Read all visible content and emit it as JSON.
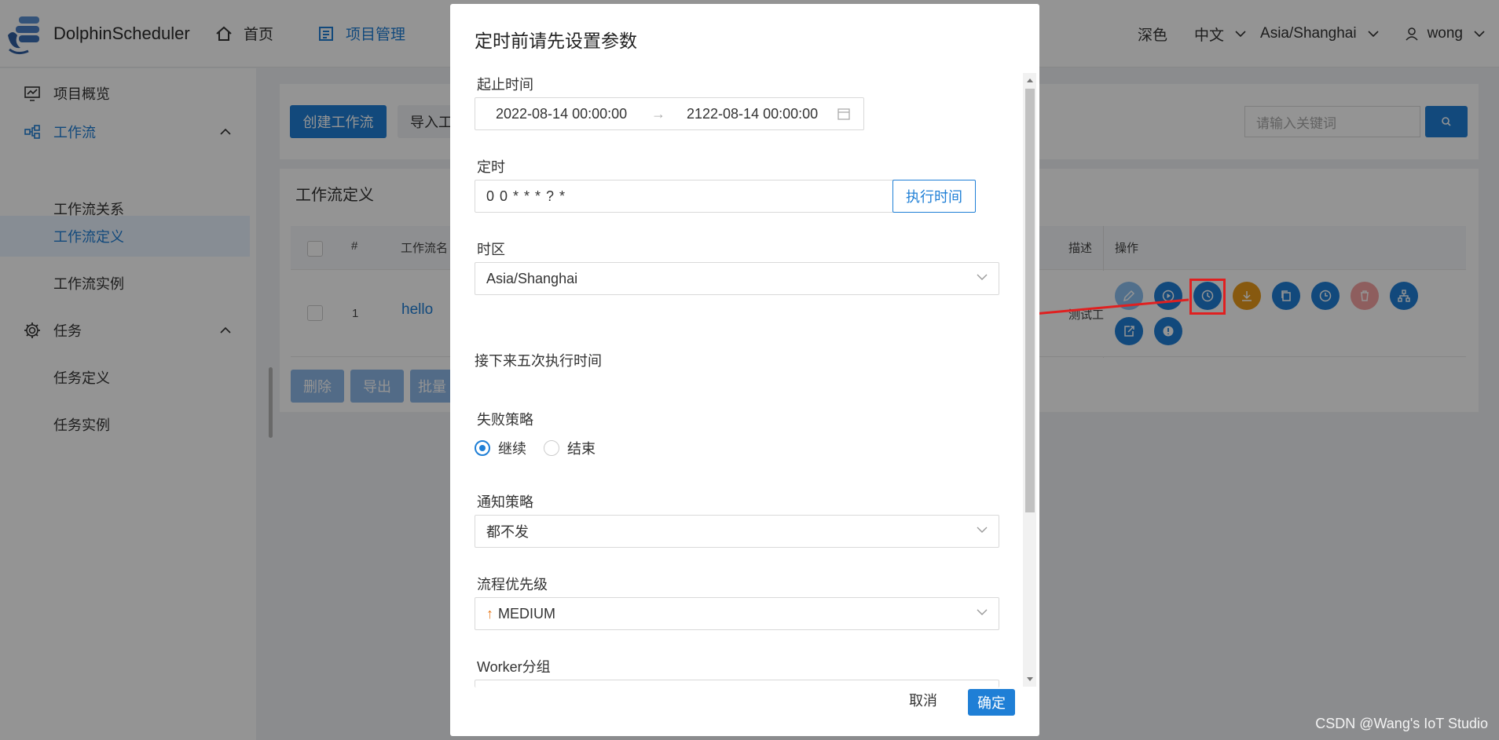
{
  "header": {
    "app_name": "DolphinScheduler",
    "nav": [
      {
        "label": "首页",
        "icon": "home-icon"
      },
      {
        "label": "项目管理",
        "icon": "project-icon"
      }
    ],
    "theme": "深色",
    "language": "中文",
    "timezone": "Asia/Shanghai",
    "user": "wong"
  },
  "sidebar": {
    "items": [
      {
        "label": "项目概览"
      },
      {
        "label": "工作流"
      },
      {
        "label": "工作流关系"
      },
      {
        "label": "工作流定义"
      },
      {
        "label": "工作流实例"
      },
      {
        "label": "任务"
      },
      {
        "label": "任务定义"
      },
      {
        "label": "任务实例"
      }
    ]
  },
  "toolbar": {
    "create_label": "创建工作流",
    "import_label": "导入工",
    "search_placeholder": "请输入关键词"
  },
  "table": {
    "title": "工作流定义",
    "columns": [
      "#",
      "工作流名",
      "描述",
      "操作"
    ],
    "rows": [
      {
        "index": "1",
        "name": "hello",
        "desc": "测试工"
      }
    ],
    "bottom_buttons": [
      "删除",
      "导出",
      "批量"
    ]
  },
  "modal": {
    "title": "定时前请先设置参数",
    "start_end_label": "起止时间",
    "start_time": "2022-08-14 00:00:00",
    "end_time": "2122-08-14 00:00:00",
    "range_arrow": "→",
    "timing_label": "定时",
    "cron": "0 0 * * * ? *",
    "exec_time_button": "执行时间",
    "timezone_label": "时区",
    "timezone_value": "Asia/Shanghai",
    "next_five_label": "接下来五次执行时间",
    "failure_label": "失败策略",
    "failure_options": [
      "继续",
      "结束"
    ],
    "notify_label": "通知策略",
    "notify_value": "都不发",
    "priority_label": "流程优先级",
    "priority_arrow": "↑",
    "priority_value": "MEDIUM",
    "worker_label": "Worker分组",
    "cancel_label": "取消",
    "ok_label": "确定"
  },
  "watermark": "CSDN @Wang's IoT Studio",
  "colors": {
    "primary": "#1f7fd6",
    "orange": "#e89a1a",
    "pink": "#f4a3a3",
    "annotation_red": "#e02020"
  }
}
